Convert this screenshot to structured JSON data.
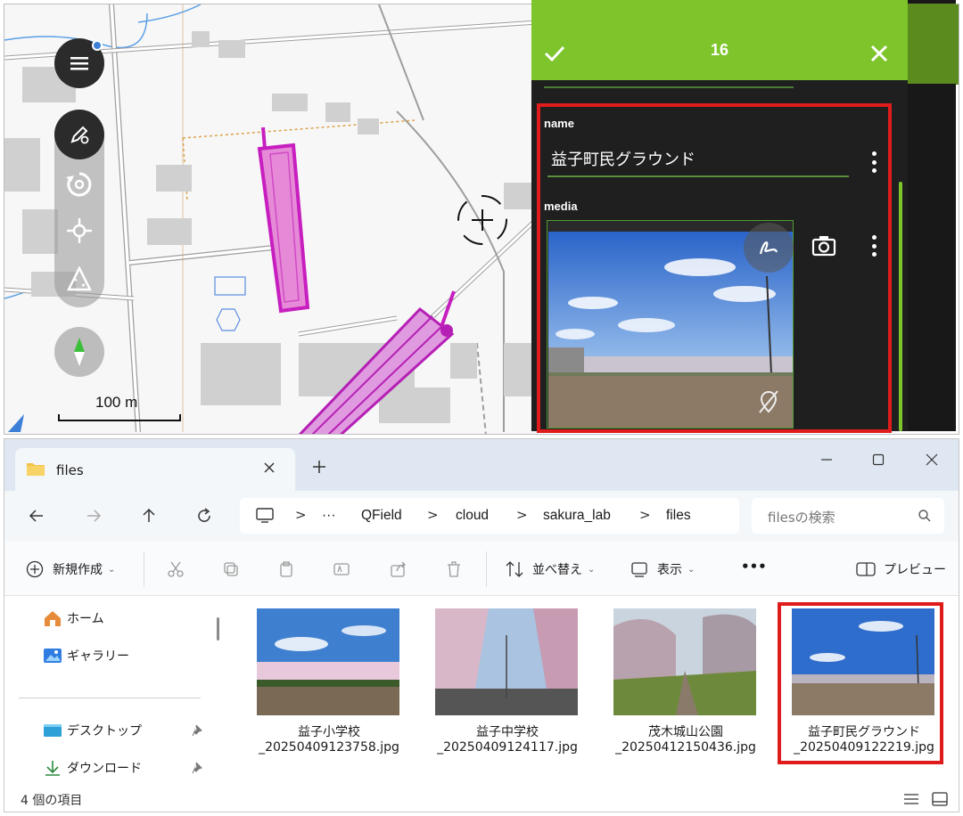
{
  "qfield": {
    "map": {
      "scale_label": "100 m",
      "accent_color": "#c71fbf"
    },
    "form": {
      "feature_count_title": "16",
      "fields": [
        {
          "label": "name",
          "value": "益子町民グラウンド"
        },
        {
          "label": "media"
        }
      ],
      "header_color": "#7dc52b"
    },
    "icons": [
      "menu-icon",
      "digitize-pen-icon",
      "rotate-icon",
      "snap-icon",
      "measure-icon",
      "compass-icon",
      "crosshair-icon",
      "check-icon",
      "close-icon",
      "sketch-icon",
      "camera-icon",
      "geotag-off-icon",
      "more-vert-icon"
    ]
  },
  "explorer": {
    "tab_title": "files",
    "breadcrumb": [
      "QField",
      "cloud",
      "sakura_lab",
      "files"
    ],
    "breadcrumb_ellipsis": "···",
    "breadcrumb_separator": ">",
    "search_placeholder": "filesの検索",
    "commands": {
      "new": "新規作成",
      "sort": "並べ替え",
      "view": "表示",
      "more": "•••",
      "preview": "プレビュー"
    },
    "sidebar": [
      {
        "label": "ホーム",
        "icon": "home-icon"
      },
      {
        "label": "ギャラリー",
        "icon": "gallery-icon"
      },
      {
        "label": "デスクトップ",
        "icon": "desktop-icon",
        "pinned": true
      },
      {
        "label": "ダウンロード",
        "icon": "download-icon",
        "pinned": true
      }
    ],
    "files": [
      {
        "line1": "益子小学校",
        "line2": "_20250409123758.jpg"
      },
      {
        "line1": "益子中学校",
        "line2": "_20250409124117.jpg"
      },
      {
        "line1": "茂木城山公園",
        "line2": "_20250412150436.jpg"
      },
      {
        "line1": "益子町民グラウンド",
        "line2": "_20250409122219.jpg"
      }
    ],
    "status_count": "4 個の項目",
    "highlight_color": "#e01b1b"
  }
}
